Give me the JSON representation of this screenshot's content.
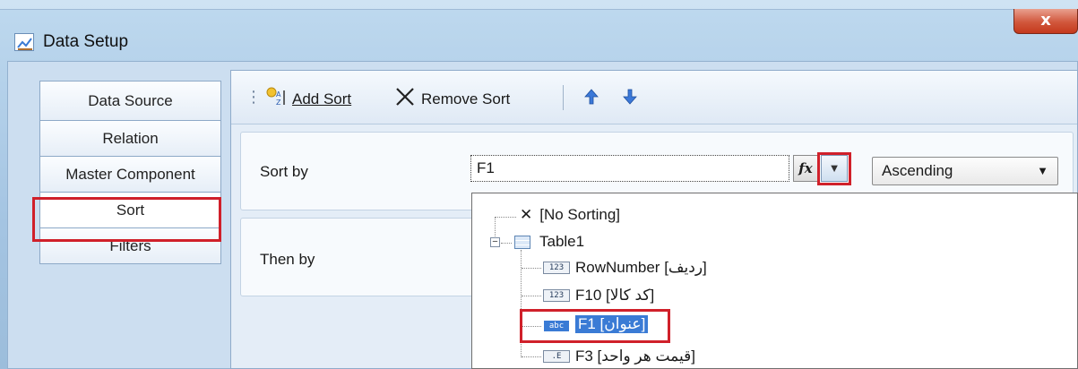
{
  "window": {
    "title": "Data Setup",
    "close_glyph": "x"
  },
  "tabs": [
    {
      "label": "Data Source"
    },
    {
      "label": "Relation"
    },
    {
      "label": "Master Component"
    },
    {
      "label": "Sort",
      "active": true
    },
    {
      "label": "Filters"
    }
  ],
  "toolbar": {
    "add_sort": "Add Sort",
    "remove_sort": "Remove Sort",
    "add_icon": "sort-ascending-icon",
    "remove_icon": "x-icon",
    "move_up_icon": "arrow-up-icon",
    "move_down_icon": "arrow-down-icon"
  },
  "sort": {
    "sort_by_label": "Sort by",
    "then_by_label": "Then by",
    "field_value": "F1",
    "fx_glyph": "fx",
    "order": "Ascending"
  },
  "tree": {
    "no_sorting": "[No Sorting]",
    "table": "Table1",
    "fields": [
      {
        "type": "123",
        "label": "RowNumber [ردیف]"
      },
      {
        "type": "123",
        "label": "F10 [کد کالا]"
      },
      {
        "type": "abc",
        "label": "F1 [عنوان]",
        "selected": true
      },
      {
        "type": ".E",
        "label": "F3 [قیمت هر واحد]"
      }
    ]
  },
  "colors": {
    "highlight": "#d0202a",
    "selection": "#3a7bd5",
    "accent": "#3b78d8"
  }
}
